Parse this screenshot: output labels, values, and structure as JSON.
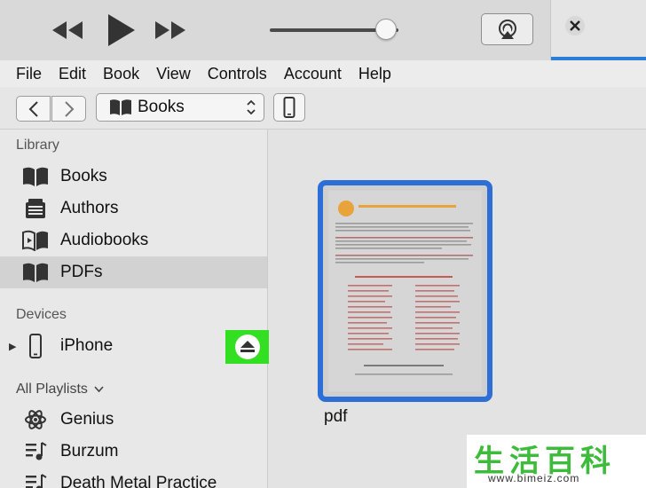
{
  "menu": [
    "File",
    "Edit",
    "Book",
    "View",
    "Controls",
    "Account",
    "Help"
  ],
  "toolbar": {
    "media_type": "Books"
  },
  "player": {
    "volume_fraction": 0.9
  },
  "sidebar": {
    "library_heading": "Library",
    "library_items": [
      {
        "label": "Books",
        "icon": "book-icon"
      },
      {
        "label": "Authors",
        "icon": "author-icon"
      },
      {
        "label": "Audiobooks",
        "icon": "audiobook-icon"
      },
      {
        "label": "PDFs",
        "icon": "pdf-icon",
        "selected": true
      }
    ],
    "devices_heading": "Devices",
    "device": {
      "label": "iPhone"
    },
    "playlists_heading": "All Playlists",
    "playlists": [
      {
        "label": "Genius",
        "icon": "genius-icon"
      },
      {
        "label": "Burzum",
        "icon": "playlist-icon"
      },
      {
        "label": "Death Metal Practice",
        "icon": "playlist-icon"
      }
    ]
  },
  "main": {
    "item_caption": "pdf"
  },
  "colors": {
    "accent": "#2d6fd6",
    "highlight": "#32e021",
    "watermark": "#3dbb3a"
  },
  "watermark": {
    "chars": "生活百科",
    "url": "www.bimeiz.com"
  }
}
